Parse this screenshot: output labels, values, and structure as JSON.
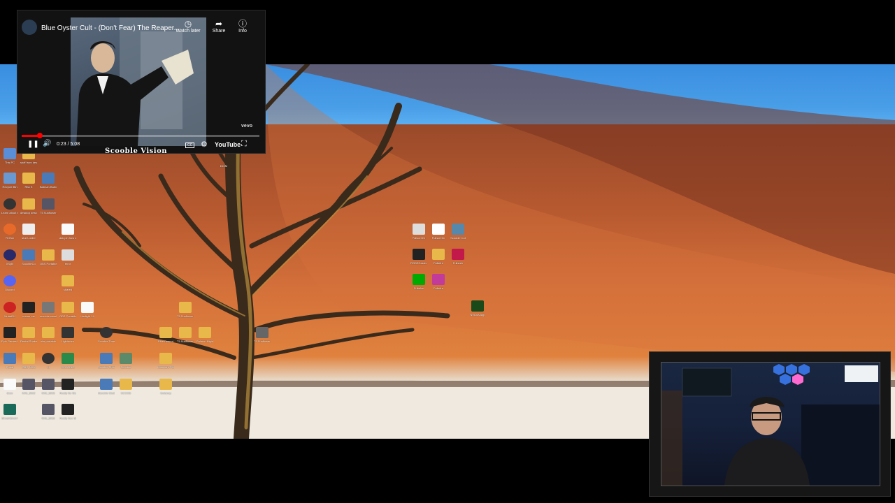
{
  "player": {
    "title": "Blue Oyster Cult - (Don't Fear) The Reaper...",
    "watch_later": "Watch later",
    "share": "Share",
    "info": "Info",
    "time": "0:23 / 5:08",
    "progress": 0.075,
    "youtube": "YouTube",
    "vevo": "vevo",
    "icons": [
      "clock-icon",
      "share-icon",
      "info-icon",
      "pause-icon",
      "volume-icon",
      "captions-icon",
      "settings-icon",
      "fullscreen-icon"
    ]
  },
  "overlay": {
    "caption": "Scooble Vision"
  },
  "desktop": {
    "icons": [
      {
        "label": "This PC"
      },
      {
        "label": "stuff from desktop"
      },
      {
        "label": "Recycle Bin"
      },
      {
        "label": "Rita S"
      },
      {
        "label": "Batman Barber"
      },
      {
        "label": "Learn about this picture"
      },
      {
        "label": "desktop desktop"
      },
      {
        "label": "T5 Sunflower Crescent"
      },
      {
        "label": "Firefox"
      },
      {
        "label": "store-order"
      },
      {
        "label": "ask pin how do you say"
      },
      {
        "label": "XSplit"
      },
      {
        "label": "ScoobleCo"
      },
      {
        "label": "OBS Portable"
      },
      {
        "label": "error"
      },
      {
        "label": "Discord"
      },
      {
        "label": "shared"
      },
      {
        "label": "VirtualDJ"
      },
      {
        "label": "cream me"
      },
      {
        "label": "scooble session"
      },
      {
        "label": "OBS Portable"
      },
      {
        "label": "Harlight 14"
      },
      {
        "label": "Epic Games Launcher"
      },
      {
        "label": "Rental Shake"
      },
      {
        "label": "obs portable"
      },
      {
        "label": "Lightroom"
      },
      {
        "label": "Scooble Time"
      },
      {
        "label": "Portal"
      },
      {
        "label": "OBS_MLN"
      },
      {
        "label": "M"
      },
      {
        "label": "SCOOBLE"
      },
      {
        "label": "Scooble Shortcut"
      },
      {
        "label": "Scooble"
      },
      {
        "label": "Kosovare Pike"
      },
      {
        "label": "doce"
      },
      {
        "label": "IMG_3992"
      },
      {
        "label": "IMG_3993"
      },
      {
        "label": "Really Se Stuck Panel"
      },
      {
        "label": "Scooble Studio"
      },
      {
        "label": "SCOOB"
      },
      {
        "label": "Getaway"
      },
      {
        "label": "StreamDeck Warner"
      },
      {
        "label": "IMG_3033"
      },
      {
        "label": "Really Sec Stuck_Mod"
      },
      {
        "label": "Blue Peanut"
      },
      {
        "label": "T5 Sunflower Crescent"
      },
      {
        "label": "Salmon Night"
      },
      {
        "label": "T5 Sunflower Crescent"
      },
      {
        "label": "T9 Sunflower Crescent"
      },
      {
        "label": "DCIM"
      },
      {
        "label": "Fullscreen"
      },
      {
        "label": "Fullscreen"
      },
      {
        "label": "Scooble Cut"
      },
      {
        "label": "RODECaster App"
      },
      {
        "label": "Fullsfire"
      },
      {
        "label": "Fullsorb"
      },
      {
        "label": "Fullsfire"
      },
      {
        "label": "Fullsfire"
      },
      {
        "label": "NVIDIA App"
      }
    ]
  },
  "colors": {
    "sky": "#3a8ee0",
    "dune": "#c8623a",
    "pan": "#f2ede4",
    "yt_red": "#ff0000"
  }
}
